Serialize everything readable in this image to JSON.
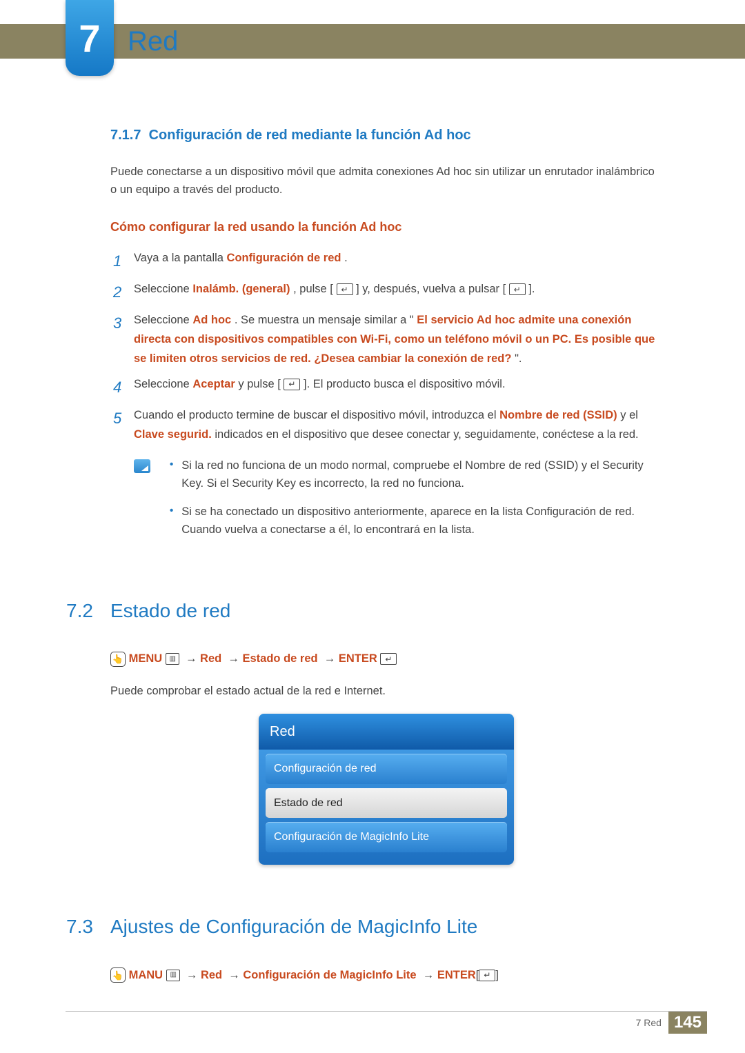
{
  "chapter": {
    "number": "7",
    "title": "Red"
  },
  "section717": {
    "number": "7.1.7",
    "title": "Configuración de red mediante la función Ad hoc",
    "intro": "Puede conectarse a un dispositivo móvil que admita conexiones Ad hoc sin utilizar un enrutador inalámbrico o un equipo a través del producto.",
    "subhead": "Cómo configurar la red usando la función Ad hoc",
    "steps": [
      {
        "pre": "Vaya a la pantalla ",
        "b1": "Configuración de red",
        "post": "."
      },
      {
        "pre": "Seleccione ",
        "b1": "Inalámb. (general)",
        "mid1": ", pulse [",
        "mid2": "] y, después, vuelva a pulsar [",
        "post": "]."
      },
      {
        "pre": "Seleccione ",
        "b1": "Ad hoc",
        "mid1": ". Se muestra un mensaje similar a \"",
        "b2": "El servicio Ad hoc admite una conexión directa con dispositivos compatibles con Wi-Fi, como un teléfono móvil o un PC. Es posible que se limiten otros servicios de red. ¿Desea cambiar la conexión de red?",
        "post": "\"."
      },
      {
        "pre": "Seleccione ",
        "b1": "Aceptar",
        "mid1": " y pulse [",
        "post": "]. El producto busca el dispositivo móvil."
      },
      {
        "pre": "Cuando el producto termine de buscar el dispositivo móvil, introduzca el ",
        "b1": "Nombre de red (SSID)",
        "mid1": " y el ",
        "b2": "Clave segurid.",
        "post": " indicados en el dispositivo que desee conectar y, seguidamente, conéctese a la red."
      }
    ],
    "notes": [
      "Si la red no funciona de un modo normal, compruebe el Nombre de red (SSID) y el Security Key. Si el Security Key es incorrecto, la red no funciona.",
      "Si se ha conectado un dispositivo anteriormente, aparece en la lista Configuración de red. Cuando vuelva a conectarse a él, lo encontrará en la lista."
    ]
  },
  "section72": {
    "number": "7.2",
    "title": "Estado de red",
    "path": {
      "menu": "MENU",
      "p1": "Red",
      "p2": "Estado de red",
      "enter": "ENTER"
    },
    "desc": "Puede comprobar el estado actual de la red e Internet.",
    "menuBox": {
      "header": "Red",
      "items": [
        {
          "label": "Configuración de red",
          "selected": false
        },
        {
          "label": "Estado de red",
          "selected": true
        },
        {
          "label": "Configuración de MagicInfo Lite",
          "selected": false
        }
      ]
    }
  },
  "section73": {
    "number": "7.3",
    "title": "Ajustes de Configuración de MagicInfo Lite",
    "path": {
      "menu": "MANU",
      "p1": "Red",
      "p2": "Configuración de MagicInfo Lite",
      "enter": "ENTER"
    }
  },
  "footer": {
    "label": "7 Red",
    "page": "145"
  }
}
